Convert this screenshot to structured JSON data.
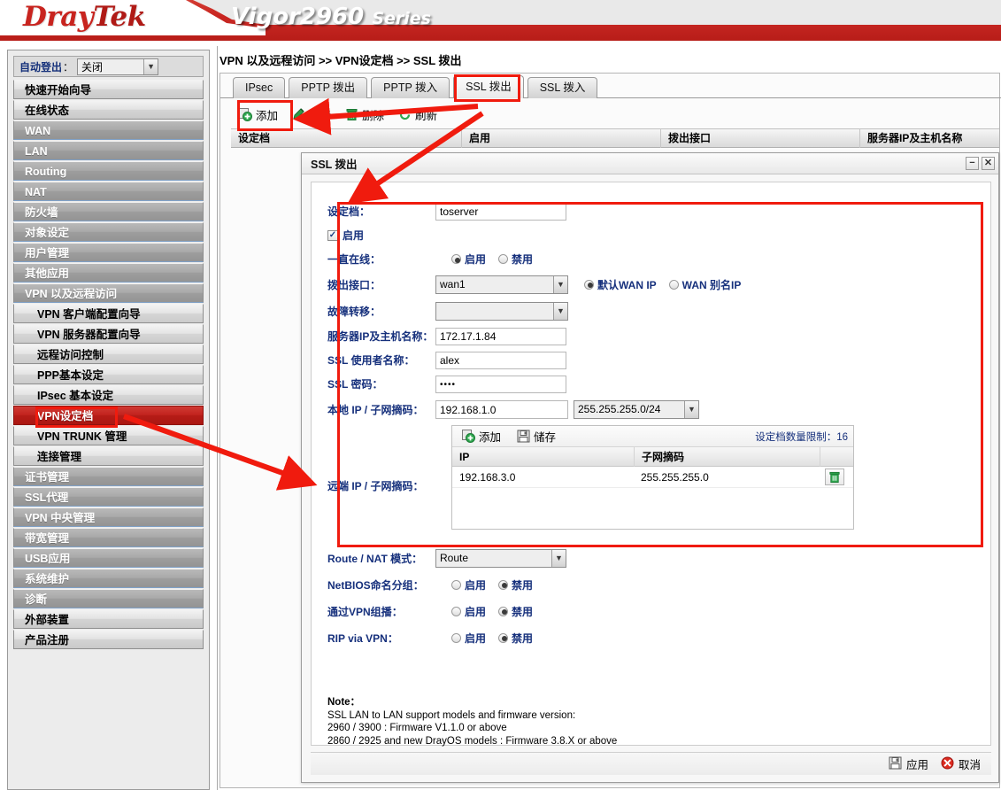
{
  "banner": {
    "brand_dray": "Dray",
    "brand_tek": "Tek",
    "model": "Vigor2960",
    "series": "Series",
    "brand_color": "#c8241f"
  },
  "sidebar": {
    "autologout": {
      "label": "自动登出",
      "colon": "：",
      "value": "关闭"
    },
    "items": [
      {
        "label": "快速开始向导",
        "level": "top"
      },
      {
        "label": "在线状态",
        "level": "top"
      },
      {
        "label": "WAN",
        "level": "grey"
      },
      {
        "label": "LAN",
        "level": "grey"
      },
      {
        "label": "Routing",
        "level": "grey"
      },
      {
        "label": "NAT",
        "level": "grey"
      },
      {
        "label": "防火墙",
        "level": "grey"
      },
      {
        "label": "对象设定",
        "level": "grey"
      },
      {
        "label": "用户管理",
        "level": "grey"
      },
      {
        "label": "其他应用",
        "level": "grey"
      },
      {
        "label": "VPN 以及远程访问",
        "level": "grey"
      },
      {
        "label": "VPN 客户端配置向导",
        "level": "sub"
      },
      {
        "label": "VPN 服务器配置向导",
        "level": "sub"
      },
      {
        "label": "远程访问控制",
        "level": "sub"
      },
      {
        "label": "PPP基本设定",
        "level": "sub"
      },
      {
        "label": "IPsec 基本设定",
        "level": "sub"
      },
      {
        "label": "VPN设定档",
        "level": "sub",
        "active": true
      },
      {
        "label": "VPN TRUNK 管理",
        "level": "sub"
      },
      {
        "label": "连接管理",
        "level": "sub"
      },
      {
        "label": "证书管理",
        "level": "grey"
      },
      {
        "label": "SSL代理",
        "level": "grey"
      },
      {
        "label": "VPN 中央管理",
        "level": "grey"
      },
      {
        "label": "带宽管理",
        "level": "grey"
      },
      {
        "label": "USB应用",
        "level": "grey"
      },
      {
        "label": "系统维护",
        "level": "grey"
      },
      {
        "label": "诊断",
        "level": "grey"
      },
      {
        "label": "外部装置",
        "level": "top"
      },
      {
        "label": "产品注册",
        "level": "top"
      }
    ]
  },
  "main": {
    "breadcrumb": "VPN 以及远程访问 >> VPN设定档 >> SSL 拨出",
    "tabs": [
      {
        "label": "IPsec",
        "selected": false
      },
      {
        "label": "PPTP 拨出",
        "selected": false
      },
      {
        "label": "PPTP 拨入",
        "selected": false
      },
      {
        "label": "SSL 拨出",
        "selected": true
      },
      {
        "label": "SSL 拨入",
        "selected": false
      }
    ],
    "toolbar": [
      {
        "label": "添加",
        "icon": "add-icon"
      },
      {
        "label": "编辑",
        "icon": "edit-icon"
      },
      {
        "label": "删除",
        "icon": "delete-icon"
      },
      {
        "label": "刷新",
        "icon": "refresh-icon"
      }
    ],
    "list_columns": [
      "设定档",
      "启用",
      "拨出接口",
      "服务器IP及主机名称"
    ]
  },
  "dialog": {
    "title": "SSL 拨出",
    "minimize_glyph": "−",
    "close_glyph": "✕",
    "profile": {
      "label": "设定档",
      "colon": "：",
      "value": "toserver"
    },
    "enable_checkbox": {
      "label": "启用",
      "checked": true,
      "check_glyph": "✓"
    },
    "always_on": {
      "label": "一直在线",
      "colon": "：",
      "options": [
        "启用",
        "禁用"
      ],
      "selected": "启用"
    },
    "dial_interface": {
      "label": "拨出接口",
      "colon": "：",
      "value": "wan1",
      "wan_options": [
        "默认WAN IP",
        "WAN 别名IP"
      ],
      "wan_selected": "默认WAN IP"
    },
    "failover": {
      "label": "故障转移",
      "colon": "：",
      "value": ""
    },
    "server_ip": {
      "label": "服务器IP及主机名称",
      "colon": "：",
      "value": "172.17.1.84"
    },
    "ssl_username": {
      "label": "SSL 使用者名称",
      "colon": "：",
      "value": "alex"
    },
    "ssl_password": {
      "label": "SSL 密码",
      "colon": "：",
      "value": "••••"
    },
    "local_ip": {
      "label": "本地 IP / 子网摘码",
      "colon": "：",
      "ip": "192.168.1.0",
      "mask": "255.255.255.0/24"
    },
    "remote": {
      "label": "远端 IP / 子网摘码",
      "colon": "：",
      "toolbar": [
        {
          "label": "添加",
          "icon": "add-icon"
        },
        {
          "label": "储存",
          "icon": "save-icon"
        }
      ],
      "limit_text": "设定档数量限制：16",
      "columns": [
        "IP",
        "子网摘码"
      ],
      "rows": [
        {
          "ip": "192.168.3.0",
          "mask": "255.255.255.0"
        }
      ]
    },
    "route_nat": {
      "label": "Route / NAT 模式",
      "colon": "：",
      "value": "Route"
    },
    "netbios": {
      "label": "NetBIOS命名分组",
      "colon": "：",
      "options": [
        "启用",
        "禁用"
      ],
      "selected": "禁用"
    },
    "multicast": {
      "label": "通过VPN组播",
      "colon": "：",
      "options": [
        "启用",
        "禁用"
      ],
      "selected": "禁用"
    },
    "rip": {
      "label": "RIP via VPN",
      "colon": "：",
      "options": [
        "启用",
        "禁用"
      ],
      "selected": "禁用"
    },
    "note": {
      "title": "Note：",
      "lines": [
        "SSL LAN to LAN support models and firmware version:",
        "2960 / 3900 : Firmware V1.1.0 or above",
        "2860 / 2925 and new DrayOS models : Firmware 3.8.X or above"
      ]
    },
    "footer": {
      "apply": "应用",
      "cancel": "取消"
    }
  },
  "annotations": {
    "color": "#f01b0e",
    "boxes": [
      "add-button-box",
      "ssl-dialout-tab-box",
      "vpn-profile-menu-box",
      "form-region-box"
    ]
  }
}
